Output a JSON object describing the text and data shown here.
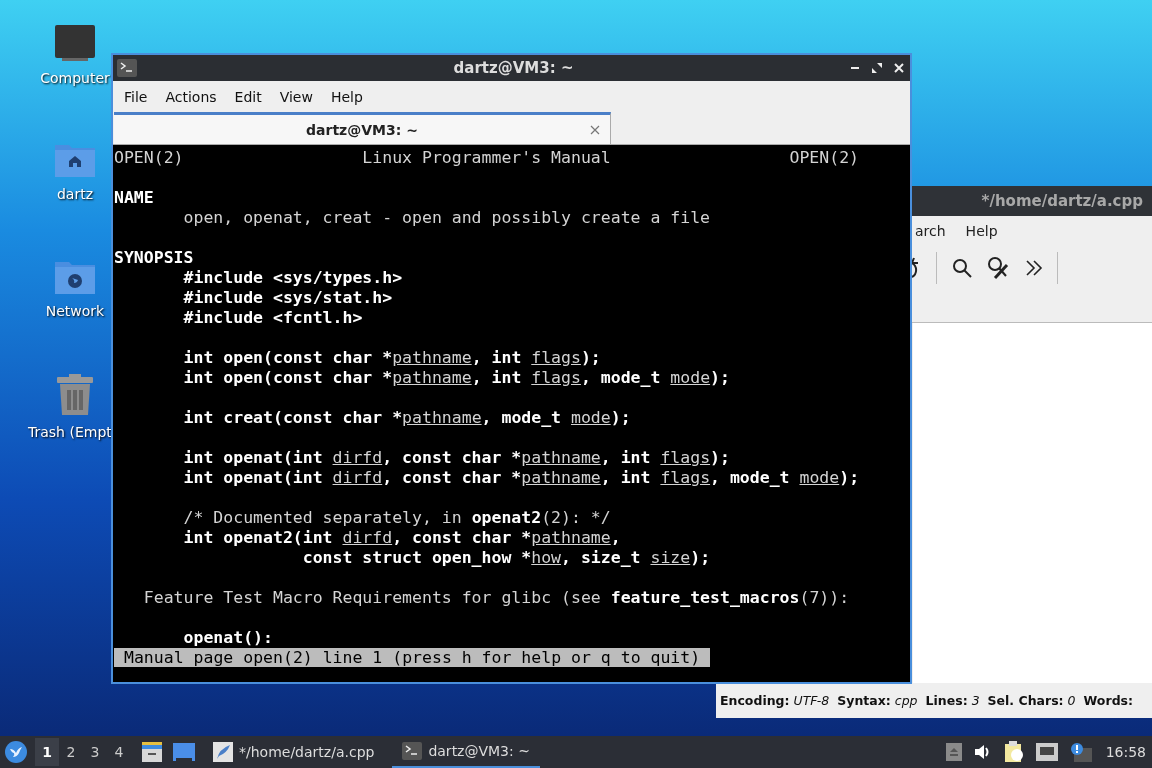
{
  "desktop_icons": [
    {
      "label": "Computer",
      "kind": "computer"
    },
    {
      "label": "dartz",
      "kind": "home"
    },
    {
      "label": "Network",
      "kind": "network"
    },
    {
      "label": "Trash (Empt",
      "kind": "trash"
    }
  ],
  "editor": {
    "title": "*/home/dartz/a.cpp",
    "menu": [
      "arch",
      "Help"
    ],
    "status": [
      {
        "label": "Encoding:",
        "value": "UTF-8"
      },
      {
        "label": "Syntax:",
        "value": "cpp"
      },
      {
        "label": "Lines:",
        "value": "3"
      },
      {
        "label": "Sel. Chars:",
        "value": "0"
      },
      {
        "label": "Words:"
      }
    ]
  },
  "terminal": {
    "title": "dartz@VM3: ~",
    "menu": [
      "File",
      "Actions",
      "Edit",
      "View",
      "Help"
    ],
    "tabs": [
      {
        "label": "dartz@VM3: ~",
        "selected": true
      }
    ],
    "blocks": [
      [
        [
          {
            "kind": "plain",
            "text": "OPEN(2)                  Linux Programmer's Manual                  OPEN(2)"
          }
        ]
      ],
      [
        [
          {
            "kind": "bold",
            "text": "NAME"
          }
        ],
        [
          {
            "kind": "plain",
            "text": "       open, openat, creat - open and possibly create a file"
          }
        ]
      ],
      [
        [
          {
            "kind": "bold",
            "text": "SYNOPSIS"
          }
        ],
        [
          {
            "kind": "bold",
            "text": "       #include <sys/types.h>"
          }
        ],
        [
          {
            "kind": "bold",
            "text": "       #include <sys/stat.h>"
          }
        ],
        [
          {
            "kind": "bold",
            "text": "       #include <fcntl.h>"
          }
        ]
      ],
      [
        [
          {
            "kind": "bold",
            "text": "       int open(const char *"
          },
          {
            "kind": "underline",
            "text": "pathname"
          },
          {
            "kind": "bold",
            "text": ", int "
          },
          {
            "kind": "underline",
            "text": "flags"
          },
          {
            "kind": "bold",
            "text": ");"
          }
        ],
        [
          {
            "kind": "bold",
            "text": "       int open(const char *"
          },
          {
            "kind": "underline",
            "text": "pathname"
          },
          {
            "kind": "bold",
            "text": ", int "
          },
          {
            "kind": "underline",
            "text": "flags"
          },
          {
            "kind": "bold",
            "text": ", mode_t "
          },
          {
            "kind": "underline",
            "text": "mode"
          },
          {
            "kind": "bold",
            "text": ");"
          }
        ]
      ],
      [
        [
          {
            "kind": "bold",
            "text": "       int creat(const char *"
          },
          {
            "kind": "underline",
            "text": "pathname"
          },
          {
            "kind": "bold",
            "text": ", mode_t "
          },
          {
            "kind": "underline",
            "text": "mode"
          },
          {
            "kind": "bold",
            "text": ");"
          }
        ]
      ],
      [
        [
          {
            "kind": "bold",
            "text": "       int openat(int "
          },
          {
            "kind": "underline",
            "text": "dirfd"
          },
          {
            "kind": "bold",
            "text": ", const char *"
          },
          {
            "kind": "underline",
            "text": "pathname"
          },
          {
            "kind": "bold",
            "text": ", int "
          },
          {
            "kind": "underline",
            "text": "flags"
          },
          {
            "kind": "bold",
            "text": ");"
          }
        ],
        [
          {
            "kind": "bold",
            "text": "       int openat(int "
          },
          {
            "kind": "underline",
            "text": "dirfd"
          },
          {
            "kind": "bold",
            "text": ", const char *"
          },
          {
            "kind": "underline",
            "text": "pathname"
          },
          {
            "kind": "bold",
            "text": ", int "
          },
          {
            "kind": "underline",
            "text": "flags"
          },
          {
            "kind": "bold",
            "text": ", mode_t "
          },
          {
            "kind": "underline",
            "text": "mode"
          },
          {
            "kind": "bold",
            "text": ");"
          }
        ]
      ],
      [
        [
          {
            "kind": "plain",
            "text": "       /* Documented separately, in "
          },
          {
            "kind": "bold",
            "text": "openat2"
          },
          {
            "kind": "plain",
            "text": "(2): */"
          }
        ],
        [
          {
            "kind": "bold",
            "text": "       int openat2(int "
          },
          {
            "kind": "underline",
            "text": "dirfd"
          },
          {
            "kind": "bold",
            "text": ", const char *"
          },
          {
            "kind": "underline",
            "text": "pathname"
          },
          {
            "kind": "bold",
            "text": ","
          }
        ],
        [
          {
            "kind": "bold",
            "text": "                   const struct open_how *"
          },
          {
            "kind": "underline",
            "text": "how"
          },
          {
            "kind": "bold",
            "text": ", size_t "
          },
          {
            "kind": "underline",
            "text": "size"
          },
          {
            "kind": "bold",
            "text": ");"
          }
        ]
      ],
      [
        [
          {
            "kind": "plain",
            "text": "   Feature Test Macro Requirements for glibc (see "
          },
          {
            "kind": "bold",
            "text": "feature_test_macros"
          },
          {
            "kind": "plain",
            "text": "(7)):"
          }
        ]
      ],
      [
        [
          {
            "kind": "bold",
            "text": "       openat():"
          }
        ]
      ]
    ],
    "pager_status": "Manual page open(2) line 1 (press h for help or q to quit)"
  },
  "taskbar": {
    "workspaces": [
      {
        "label": "1",
        "selected": true
      },
      {
        "label": "2",
        "selected": false
      },
      {
        "label": "3",
        "selected": false
      },
      {
        "label": "4",
        "selected": false
      }
    ],
    "tasks": [
      {
        "label": "*/home/dartz/a.cpp",
        "kind": "editor",
        "selected": false
      },
      {
        "label": "dartz@VM3: ~",
        "kind": "terminal",
        "selected": true
      }
    ],
    "clock": "16:58"
  }
}
